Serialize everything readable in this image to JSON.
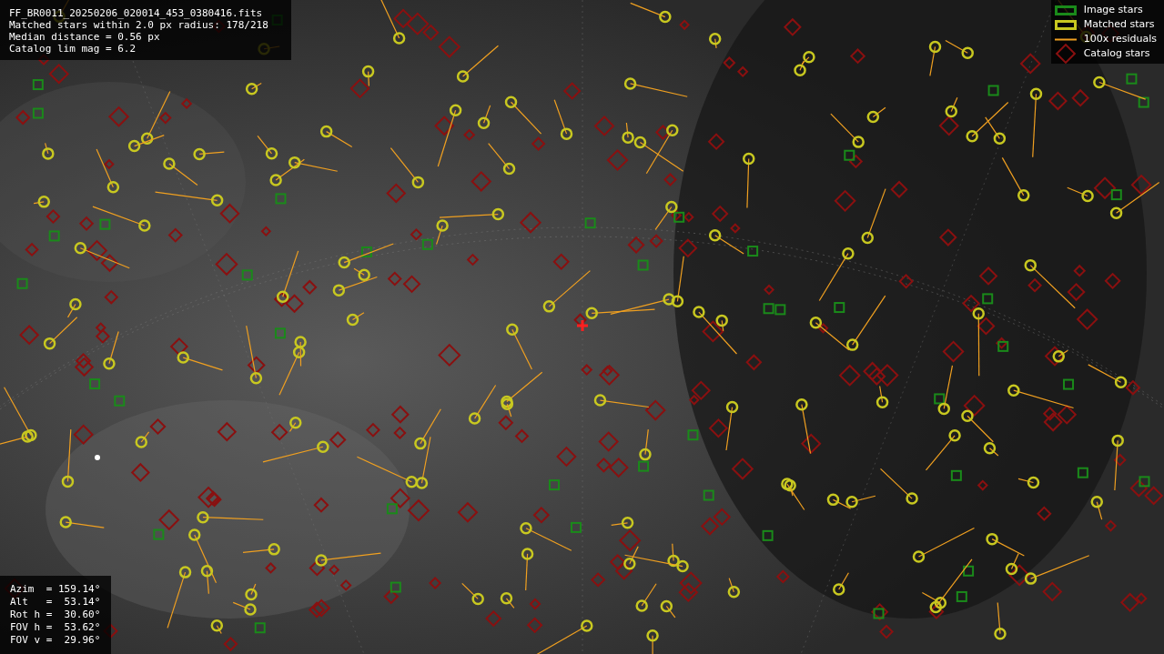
{
  "info": {
    "lines": [
      "FF_BR0011_20250206_020014_453_0380416.fits",
      "Matched stars within 2.0 px radius: 178/218",
      "Median distance = 0.56 px",
      "Catalog lim mag = 6.2"
    ]
  },
  "legend": [
    {
      "kind": "box",
      "label": "Image stars",
      "color": "#1a8a1a"
    },
    {
      "kind": "box",
      "label": "Matched stars",
      "color": "#c8c820"
    },
    {
      "kind": "line",
      "label": "100x residuals",
      "color": "#f0a020"
    },
    {
      "kind": "diamond",
      "label": "Catalog stars",
      "color": "#8a1010"
    }
  ],
  "pointing": {
    "lines": [
      "Azim  = 159.14°",
      "Alt   =  53.14°",
      "Rot h =  30.60°",
      "FOV h =  53.62°",
      "FOV v =  29.96°"
    ]
  }
}
